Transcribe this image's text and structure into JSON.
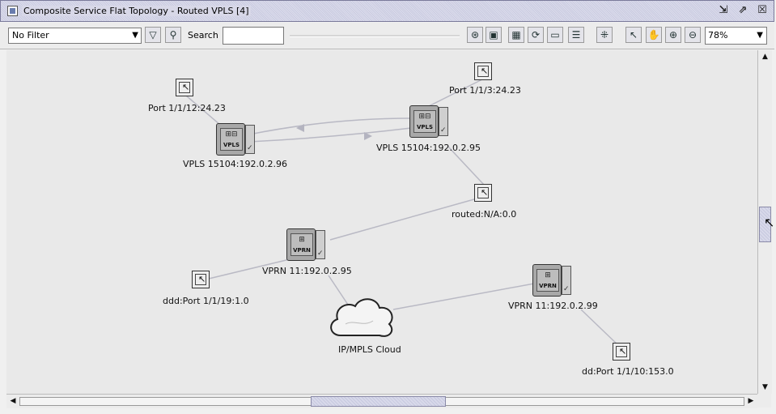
{
  "window": {
    "title": "Composite Service Flat Topology - Routed VPLS [4]",
    "controls": [
      "restore-icon",
      "maximize-icon",
      "close-icon"
    ]
  },
  "toolbar": {
    "filter_value": "No Filter",
    "search_label": "Search",
    "search_value": "",
    "zoom_value": "78%"
  },
  "nodes": {
    "port_1": "Port 1/1/12:24.23",
    "port_2": "Port 1/1/3:24.23",
    "vpls_96": "VPLS 15104:192.0.2.96",
    "vpls_95": "VPLS 15104:192.0.2.95",
    "routed": "routed:N/A:0.0",
    "vprn_95": "VPRN 11:192.0.2.95",
    "ddd_port": "ddd:Port 1/1/19:1.0",
    "vprn_99": "VPRN 11:192.0.2.99",
    "cloud": "IP/MPLS Cloud",
    "dd_port": "dd:Port 1/1/10:153.0",
    "vpls_tag": "VPLS",
    "vprn_tag": "VPRN"
  }
}
